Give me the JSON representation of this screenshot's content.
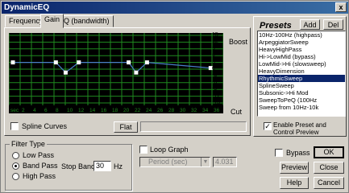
{
  "window": {
    "title": "DynamicEQ",
    "close_glyph": "x"
  },
  "tabs": [
    {
      "label": "Frequency"
    },
    {
      "label": "Gain"
    },
    {
      "label": "Q (bandwidth)"
    }
  ],
  "graph": {
    "db_labels": [
      "15",
      "12",
      "9",
      "6",
      "3",
      "0",
      "-3",
      "-6",
      "-9",
      "-12",
      "-15"
    ],
    "x_labels": [
      "sec",
      "2",
      "4",
      "6",
      "8",
      "10",
      "12",
      "14",
      "16",
      "18",
      "20",
      "22",
      "24",
      "26",
      "28",
      "30",
      "32",
      "34",
      "36"
    ],
    "boost_label": "Boost",
    "cut_label": "Cut",
    "curve_points": [
      {
        "time": 0,
        "db": 3.0
      },
      {
        "time": 7.5,
        "db": 3.0
      },
      {
        "time": 9.2,
        "db": -1.5
      },
      {
        "time": 11.5,
        "db": 3.0
      },
      {
        "time": 20.2,
        "db": 3.0
      },
      {
        "time": 21.5,
        "db": -1.5
      },
      {
        "time": 23.4,
        "db": 3.0
      },
      {
        "time": 34.5,
        "db": 0.5
      }
    ],
    "time_max": 36,
    "db_range": [
      -15,
      15
    ],
    "colors": {
      "background": "#000000",
      "grid": "#1f8a1f",
      "curve": "#4a7ec8",
      "handle": "#ffffff"
    }
  },
  "graph_controls": {
    "spline_label": "Spline Curves",
    "flat_label": "Flat"
  },
  "presets": {
    "title": "Presets",
    "add_label": "Add",
    "del_label": "Del",
    "items": [
      "10Hz-100Hz (highpass)",
      "ArpeggiatorSweep",
      "HeavyHighPass",
      "Hi->LowMid (bypass)",
      "LowMid->Hi (slowsweep)",
      "HeavyDimension",
      "RhythmicSweep",
      "SplineSweep",
      "Subsonic->Hi Mod",
      "SweepToPeQ (100Hz",
      "Sweep from 10Hz-10k"
    ],
    "selected_index": 6,
    "enable_label": "Enable Preset and Control Preview"
  },
  "filter_type": {
    "group_label": "Filter Type",
    "options": [
      "Low Pass",
      "Band Pass",
      "High Pass"
    ],
    "selected_index": 1,
    "stop_band_label": "Stop Band",
    "stop_band_value": "30",
    "stop_band_unit": "Hz"
  },
  "loop_graph": {
    "label": "Loop Graph",
    "period_label": "Period (sec)",
    "period_value": "4.031"
  },
  "bypass_label": "Bypass",
  "buttons": {
    "ok": "OK",
    "preview": "Preview",
    "cancel": "Close",
    "help": "Help",
    "cancel2": "Cancel"
  }
}
